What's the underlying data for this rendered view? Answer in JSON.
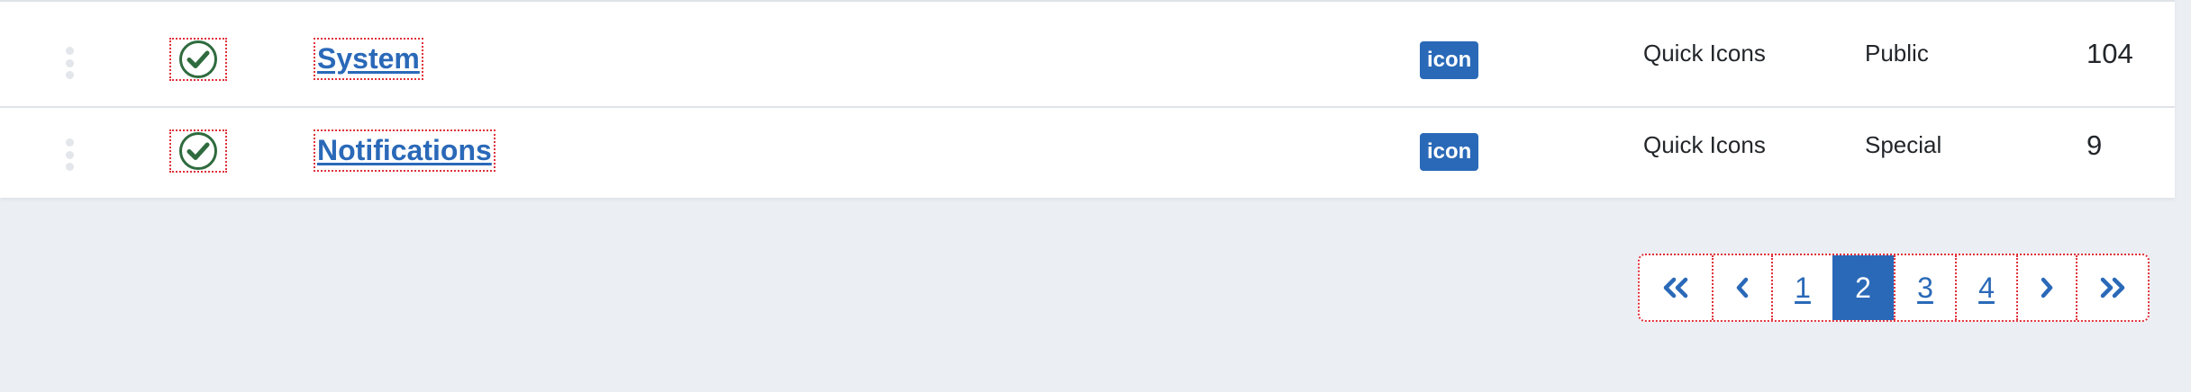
{
  "rows": [
    {
      "status_icon": "check-circle-icon",
      "title": "System",
      "badge": "icon",
      "position": "Quick Icons",
      "access": "Public",
      "id": "104"
    },
    {
      "status_icon": "check-circle-icon",
      "title": "Notifications",
      "badge": "icon",
      "position": "Quick Icons",
      "access": "Special",
      "id": "9"
    }
  ],
  "pagination": {
    "pages": [
      "1",
      "2",
      "3",
      "4"
    ],
    "current": "2"
  },
  "colors": {
    "accent": "#2a69b8",
    "success": "#2f6b3e",
    "background": "#ebeff4",
    "focus_outline": "#e0303a"
  }
}
